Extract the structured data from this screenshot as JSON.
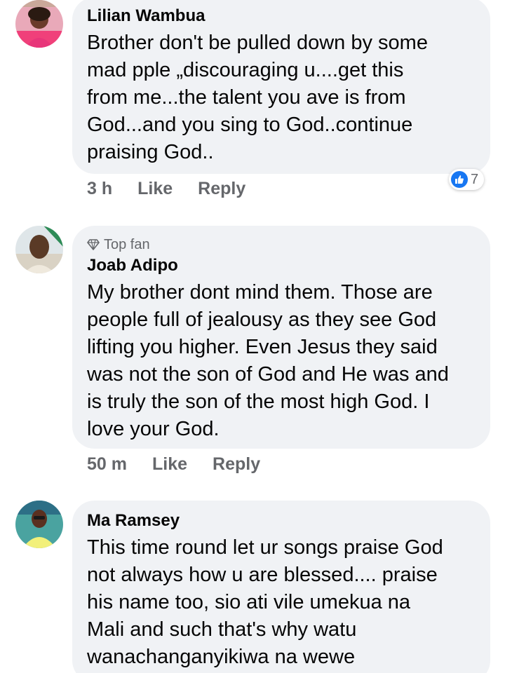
{
  "comments": [
    {
      "author": "Lilian Wambua",
      "badge": "",
      "text": "Brother don't be pulled down by some\nmad pple „discouraging u....get this\nfrom me...the talent you ave is from\nGod...and you sing to God..continue\npraising God..",
      "time": "3 h",
      "like_label": "Like",
      "reply_label": "Reply",
      "reaction_count": "7",
      "reaction_icon": "like-thumb-icon"
    },
    {
      "author": "Joab Adipo",
      "badge": "Top fan",
      "badge_icon": "diamond-icon",
      "text": "My brother dont mind them. Those are\npeople full of jealousy as they see God\nlifting you higher.  Even Jesus they said\nwas not the son of God and He was and\nis truly the son of the most high God. I\nlove your God.",
      "time": "50 m",
      "like_label": "Like",
      "reply_label": "Reply"
    },
    {
      "author": "Ma Ramsey",
      "badge": "",
      "text": "This time round let ur songs praise God\nnot always how u are blessed.... praise\nhis name too, sio ati vile umekua na\nMali and such that's why watu\nwanachanganyikiwa na wewe",
      "time": "",
      "like_label": "",
      "reply_label": ""
    }
  ],
  "colors": {
    "bubble_bg": "#f0f2f5",
    "text": "#050505",
    "meta": "#65676b",
    "like_blue": "#1877f2"
  }
}
